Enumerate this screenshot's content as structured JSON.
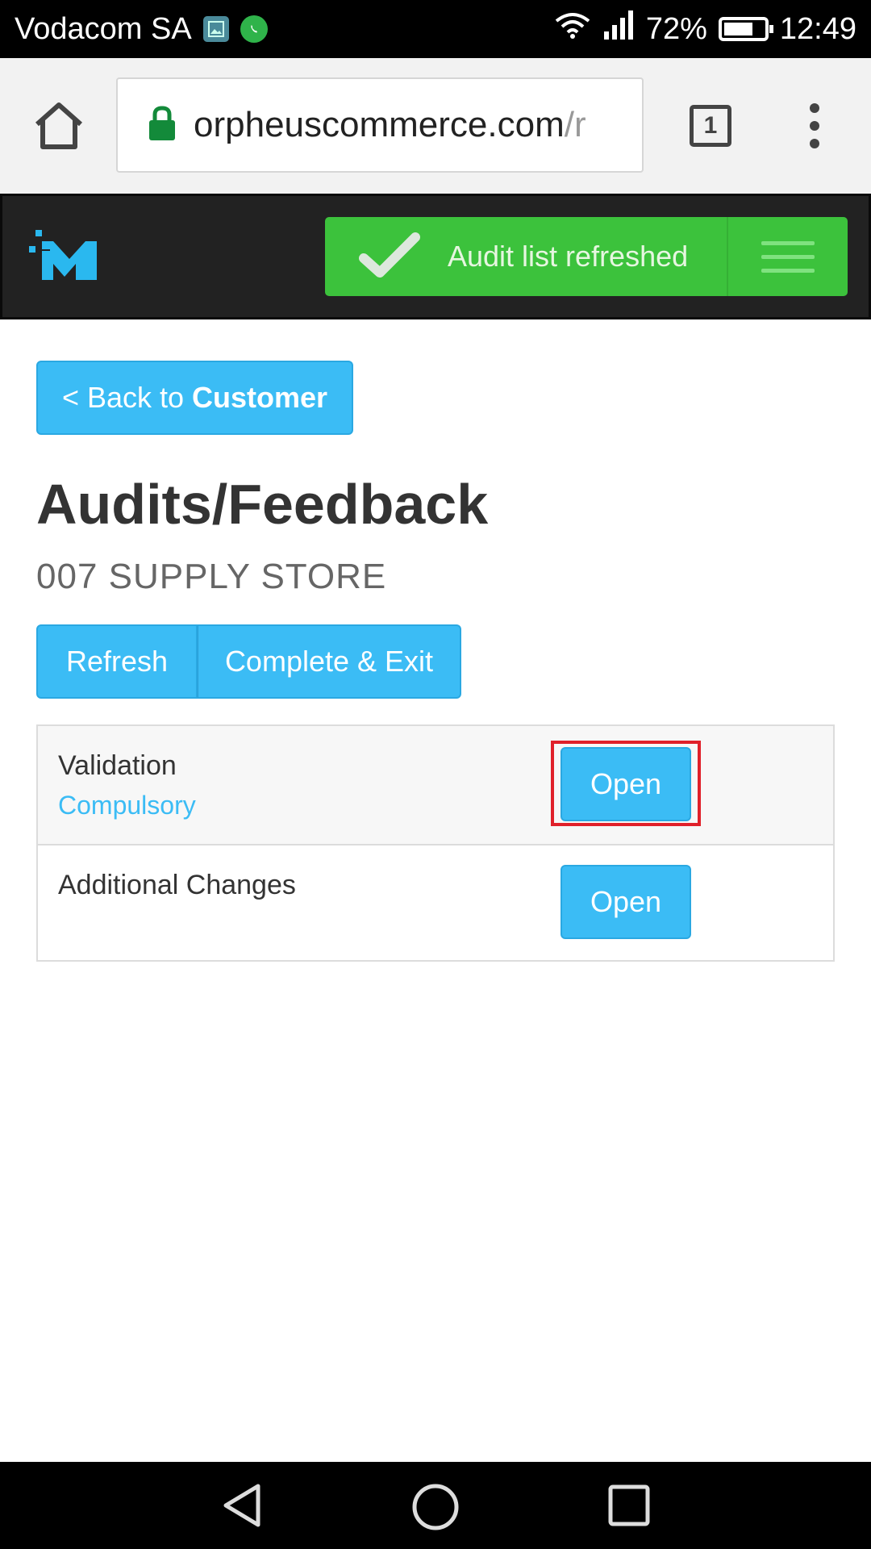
{
  "status_bar": {
    "carrier": "Vodacom SA",
    "battery_percent": "72%",
    "battery_level": 0.72,
    "time": "12:49"
  },
  "browser": {
    "url_main": "orpheuscommerce.com",
    "url_rest": "/r",
    "tab_count": "1",
    "icons": [
      "home-icon",
      "lock-icon",
      "tabs-icon",
      "more-vert-icon"
    ]
  },
  "header": {
    "toast_text": "Audit list refreshed",
    "toast_color": "#3cc23c"
  },
  "content": {
    "back_prefix": "< Back to",
    "back_bold": "Customer",
    "title": "Audits/Feedback",
    "store_name": "007 SUPPLY STORE",
    "actions": {
      "refresh": "Refresh",
      "complete_exit": "Complete & Exit"
    },
    "audits": [
      {
        "name": "Validation",
        "tag": "Compulsory",
        "button": "Open"
      },
      {
        "name": "Additional Changes",
        "tag": "",
        "button": "Open"
      }
    ]
  },
  "colors": {
    "accent": "#3bbcf5",
    "header_bg": "#222222",
    "highlight": "#e0202a"
  }
}
